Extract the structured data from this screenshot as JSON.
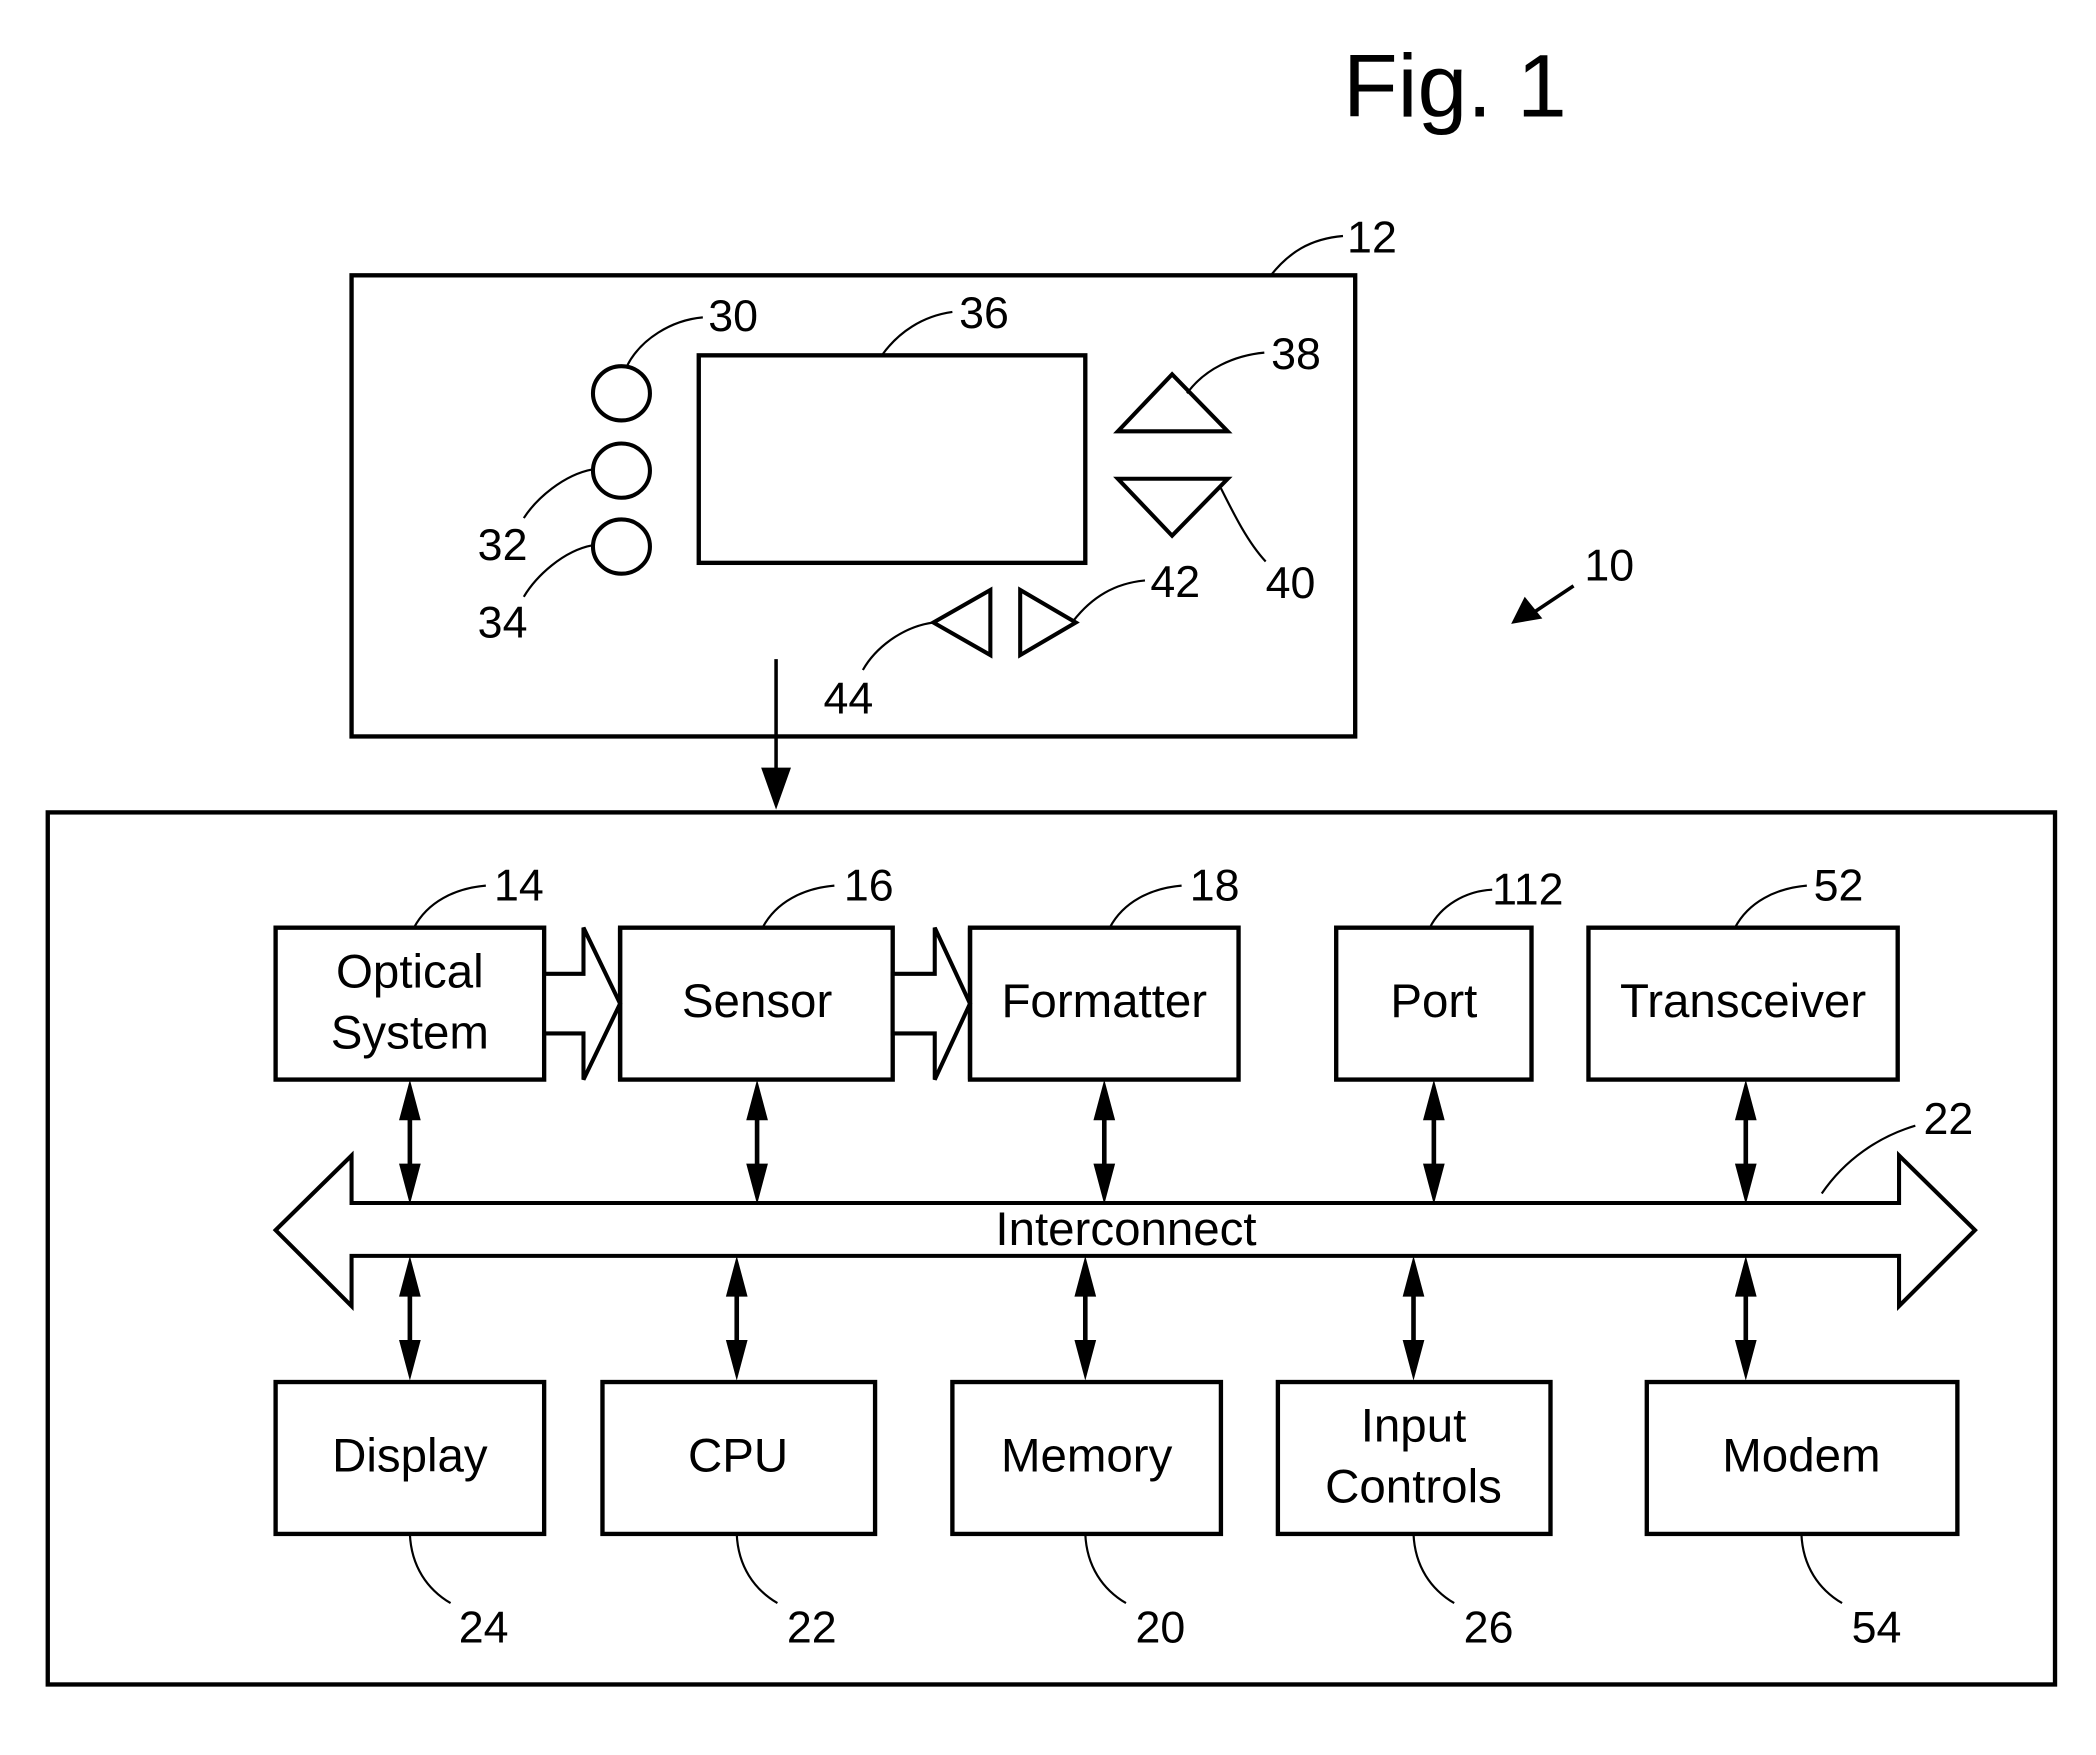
{
  "figure": {
    "title": "Fig. 1",
    "system_ref": "10",
    "device": {
      "ref": "12",
      "buttons": [
        {
          "ref": "30",
          "shape": "circle"
        },
        {
          "ref": "32",
          "shape": "circle"
        },
        {
          "ref": "34",
          "shape": "circle"
        }
      ],
      "screen_ref": "36",
      "up_button_ref": "38",
      "down_button_ref": "40",
      "right_button_ref": "42",
      "left_button_ref": "44"
    },
    "top_row": [
      {
        "label_lines": [
          "Optical",
          "System"
        ],
        "ref": "14"
      },
      {
        "label": "Sensor",
        "ref": "16"
      },
      {
        "label": "Formatter",
        "ref": "18"
      },
      {
        "label": "Port",
        "ref": "112"
      },
      {
        "label": "Transceiver",
        "ref": "52"
      }
    ],
    "interconnect": {
      "label": "Interconnect",
      "ref": "22"
    },
    "bottom_row": [
      {
        "label": "Display",
        "ref": "24"
      },
      {
        "label": "CPU",
        "ref": "22"
      },
      {
        "label": "Memory",
        "ref": "20"
      },
      {
        "label_lines": [
          "Input",
          "Controls"
        ],
        "ref": "26"
      },
      {
        "label": "Modem",
        "ref": "54"
      }
    ]
  }
}
